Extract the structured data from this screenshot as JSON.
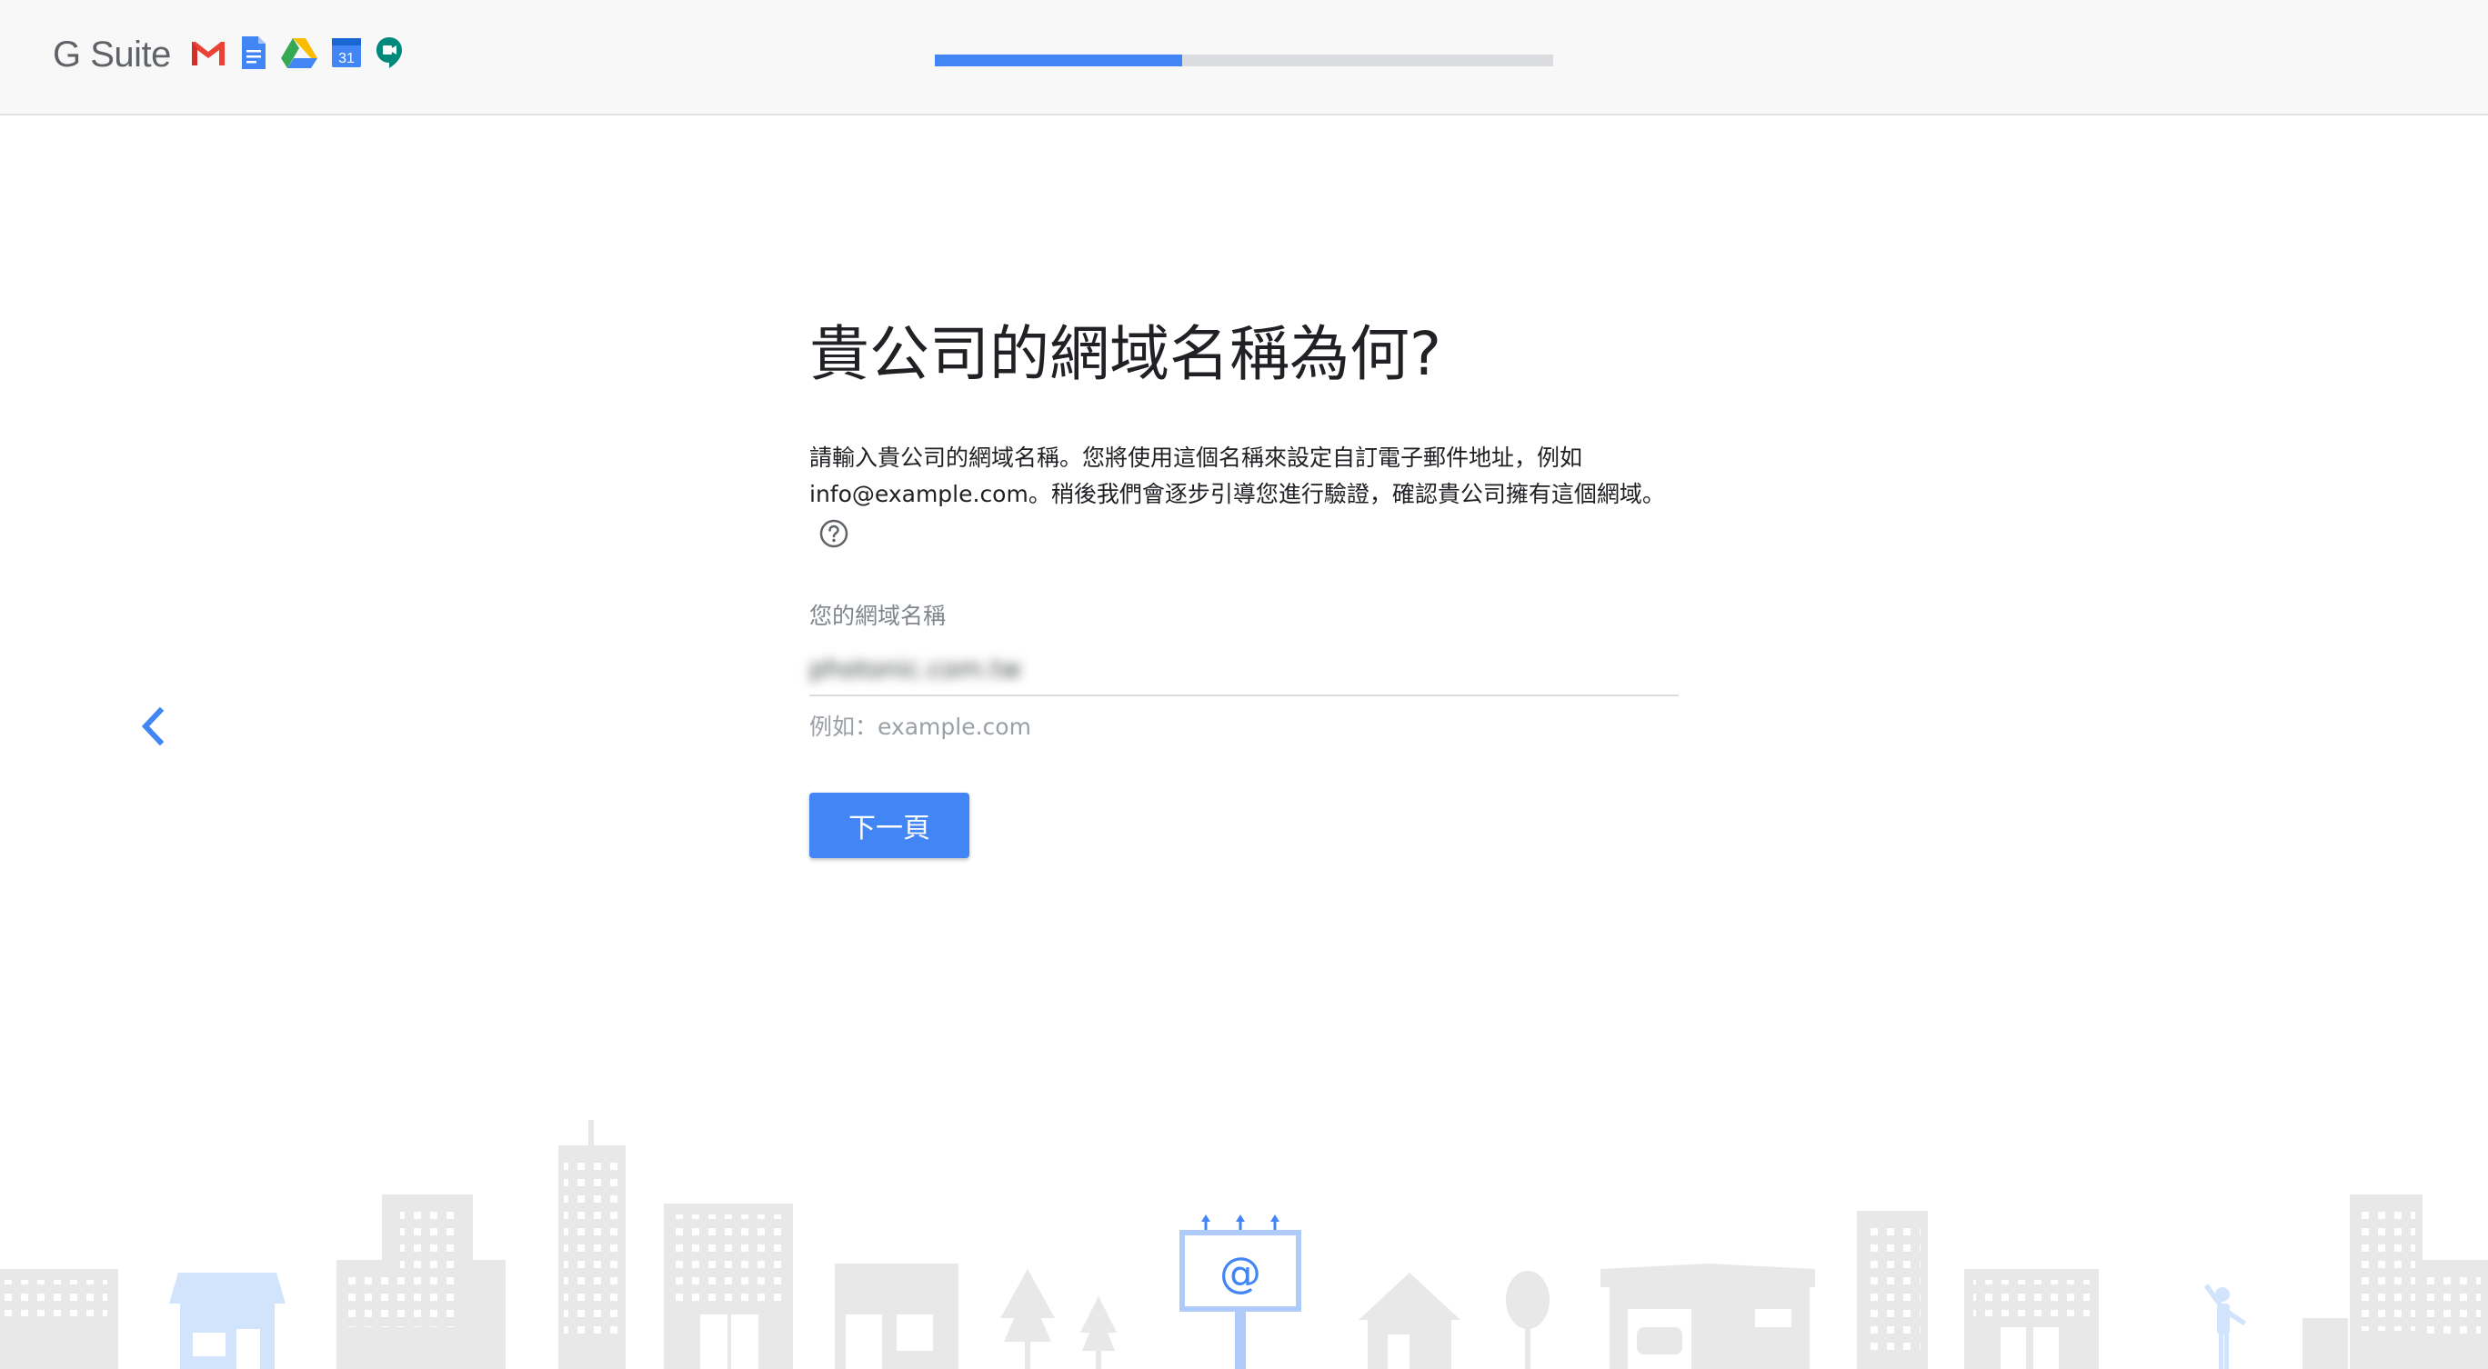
{
  "header": {
    "brand": "G Suite",
    "apps": [
      "gmail-icon",
      "docs-icon",
      "drive-icon",
      "calendar-icon",
      "meet-icon"
    ],
    "calendar_day": "31",
    "progress_fraction": 0.4
  },
  "main": {
    "title": "貴公司的網域名稱為何?",
    "description": "請輸入貴公司的網域名稱。您將使用這個名稱來設定自訂電子郵件地址，例如 info@example.com。稍後我們會逐步引導您進行驗證，確認貴公司擁有這個網域。",
    "field_label": "您的網域名稱",
    "field_value": "photonic.com.tw",
    "field_hint": "例如：example.com",
    "next_label": "下一頁"
  },
  "billboard": {
    "symbol": "@"
  },
  "colors": {
    "accent": "#4285f4",
    "skyline_gray": "#e8e8e8",
    "skyline_blue": "#d2e3fc",
    "header_bg": "#f8f8f8"
  }
}
